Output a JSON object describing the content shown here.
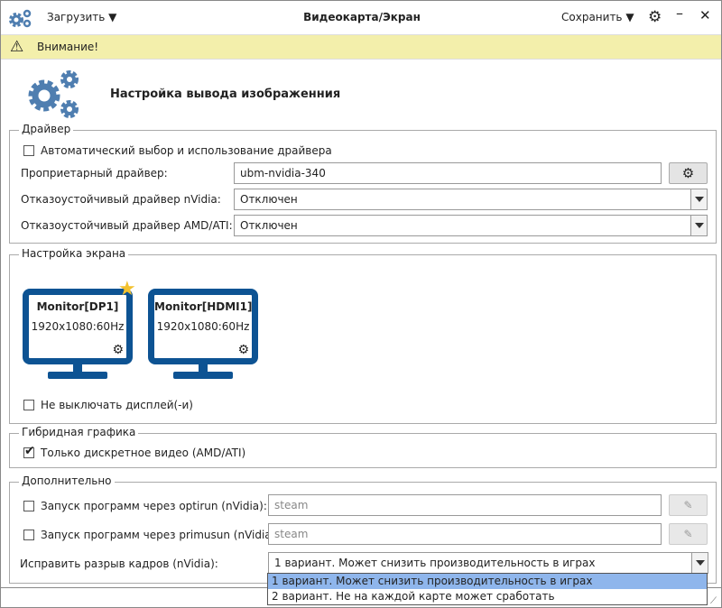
{
  "titlebar": {
    "load_label": "Загрузить",
    "title": "Видеокарта/Экран",
    "save_label": "Сохранить"
  },
  "warning": {
    "text": "Внимание!"
  },
  "header": {
    "title": "Настройка вывода изображенния"
  },
  "driver": {
    "legend": "Драйвер",
    "auto_label": "Автоматический выбор и использование драйвера",
    "auto_checked": false,
    "proprietary_label": "Проприетарный драйвер:",
    "proprietary_value": "ubm-nvidia-340",
    "nvidia_fallback_label": "Отказоустойчивый драйвер nVidia:",
    "nvidia_fallback_value": "Отключен",
    "amd_fallback_label": "Отказоустойчивый драйвер AMD/ATI:",
    "amd_fallback_value": "Отключен"
  },
  "screen": {
    "legend": "Настройка экрана",
    "monitors": [
      {
        "name": "Monitor[DP1]",
        "mode": "1920x1080:60Hz",
        "primary": true
      },
      {
        "name": "Monitor[HDMI1]",
        "mode": "1920x1080:60Hz",
        "primary": false
      }
    ],
    "keep_on_label": "Не выключать дисплей(-и)",
    "keep_on_checked": false
  },
  "hybrid": {
    "legend": "Гибридная графика",
    "discrete_label": "Только дискретное видео (AMD/ATI)",
    "discrete_checked": true
  },
  "extra": {
    "legend": "Дополнительно",
    "optirun_label": "Запуск программ через optirun (nVidia):",
    "optirun_placeholder": "steam",
    "primusun_label": "Запуск программ через primusun (nVidia):",
    "primusun_placeholder": "steam",
    "tearing_label": "Исправить разрыв кадров (nVidia):",
    "tearing_value": "1 вариант. Может снизить производительность в играх",
    "tearing_options": [
      "1 вариант. Может снизить производительность в играх",
      "2 вариант. Не на каждой карте может сработать"
    ]
  },
  "colors": {
    "accent_gear": "#4f7eb0",
    "monitor": "#0d5393",
    "warning_bg": "#f3efab",
    "selected_option": "#8fb6ec",
    "star": "#f2c12e"
  }
}
